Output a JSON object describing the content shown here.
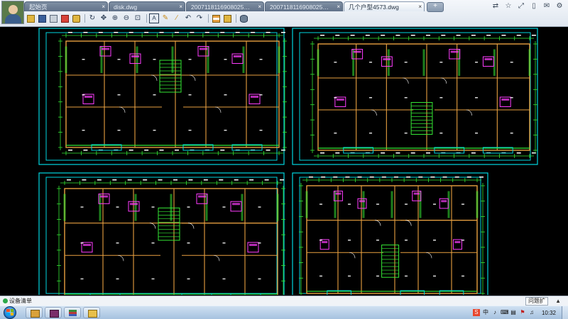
{
  "tabs": [
    {
      "label": "起始页",
      "active": false
    },
    {
      "label": "disk.dwg",
      "active": false
    },
    {
      "label": "20071181169080253886.d...",
      "active": false
    },
    {
      "label": "20071181169080253886.d...",
      "active": false
    },
    {
      "label": "几个户型4573.dwg",
      "active": true
    }
  ],
  "new_tab_label": "+",
  "window_icons": [
    "share-icon",
    "star-icon",
    "open-icon",
    "phone-icon",
    "message-icon",
    "settings-icon"
  ],
  "toolbar_icons": [
    "open-folder-icon",
    "save-icon",
    "print-icon",
    "export-pdf-icon",
    "lock-icon",
    "rotate-icon",
    "pan-icon",
    "zoom-in-icon",
    "zoom-out-icon",
    "zoom-extents-icon",
    "text-icon",
    "pencil-icon",
    "line-icon",
    "undo-icon",
    "redo-icon",
    "layers-icon",
    "layout-icon",
    "block-icon"
  ],
  "canvas": {
    "drawing_count": 4,
    "colors": {
      "frame": "#00d6e0",
      "wall": "#e8a040",
      "dimension": "#35e835",
      "highlight": "#ff3cff",
      "text": "#ffffff",
      "background": "#000000"
    }
  },
  "statusbar": {
    "left_text": "设备清单",
    "right_text": "问题扩",
    "arrow": "▲"
  },
  "taskbar": {
    "apps": [
      "browser",
      "media-player",
      "stack-app",
      "folder-app"
    ],
    "clock": "10:32",
    "tray_icons": [
      "input-s-icon",
      "zh-icon",
      "mic-icon",
      "keyboard-icon",
      "network-icon",
      "flag-icon",
      "volume-icon"
    ]
  }
}
